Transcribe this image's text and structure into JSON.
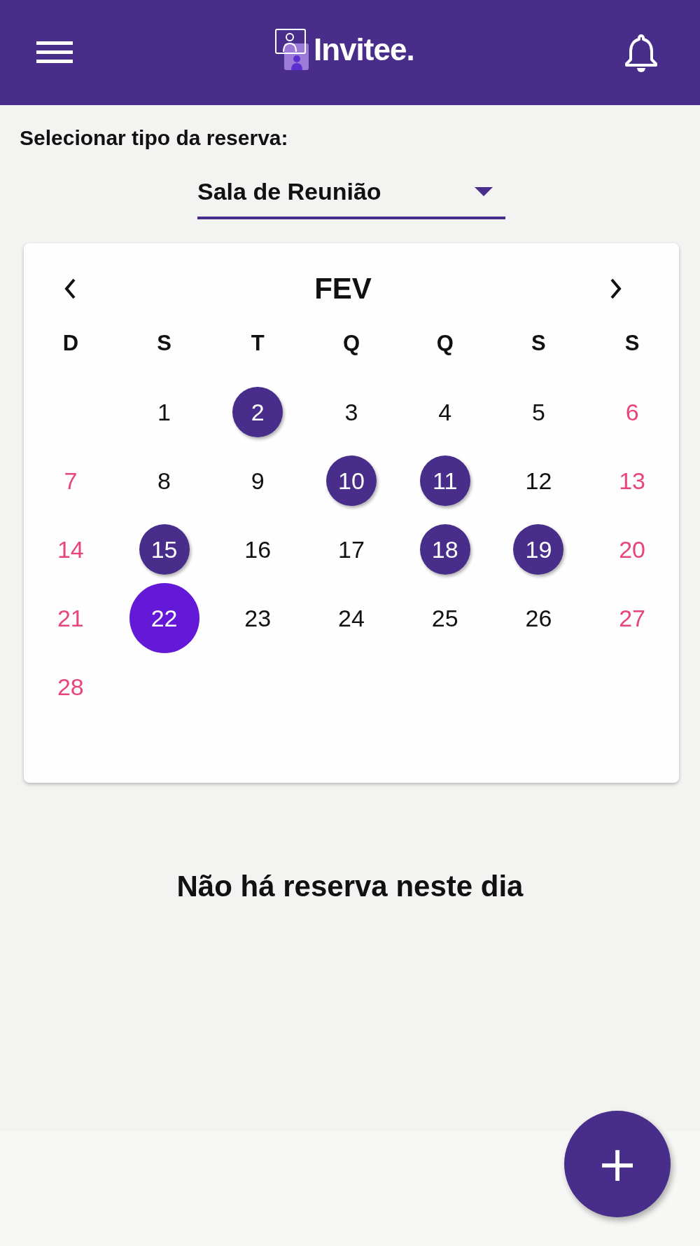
{
  "app_bar": {
    "brand": "Invitee."
  },
  "reservation_type": {
    "label": "Selecionar tipo da reserva:",
    "value": "Sala de Reunião"
  },
  "calendar": {
    "month": "FEV",
    "weekdays": [
      "D",
      "S",
      "T",
      "Q",
      "Q",
      "S",
      "S"
    ],
    "weeks": [
      [
        {
          "day": "1",
          "marked": false,
          "selected": false
        },
        {
          "day": "2",
          "marked": true,
          "selected": false
        },
        {
          "day": "3",
          "marked": false,
          "selected": false
        },
        {
          "day": "4",
          "marked": false,
          "selected": false
        },
        {
          "day": "5",
          "marked": false,
          "selected": false
        },
        {
          "day": "6",
          "marked": false,
          "selected": false
        }
      ],
      [
        {
          "day": "7",
          "marked": false,
          "selected": false
        },
        {
          "day": "8",
          "marked": false,
          "selected": false
        },
        {
          "day": "9",
          "marked": false,
          "selected": false
        },
        {
          "day": "10",
          "marked": true,
          "selected": false
        },
        {
          "day": "11",
          "marked": true,
          "selected": false
        },
        {
          "day": "12",
          "marked": false,
          "selected": false
        },
        {
          "day": "13",
          "marked": false,
          "selected": false
        }
      ],
      [
        {
          "day": "14",
          "marked": false,
          "selected": false
        },
        {
          "day": "15",
          "marked": true,
          "selected": false
        },
        {
          "day": "16",
          "marked": false,
          "selected": false
        },
        {
          "day": "17",
          "marked": false,
          "selected": false
        },
        {
          "day": "18",
          "marked": true,
          "selected": false
        },
        {
          "day": "19",
          "marked": true,
          "selected": false
        },
        {
          "day": "20",
          "marked": false,
          "selected": false
        }
      ],
      [
        {
          "day": "21",
          "marked": false,
          "selected": false
        },
        {
          "day": "22",
          "marked": false,
          "selected": true
        },
        {
          "day": "23",
          "marked": false,
          "selected": false
        },
        {
          "day": "24",
          "marked": false,
          "selected": false
        },
        {
          "day": "25",
          "marked": false,
          "selected": false
        },
        {
          "day": "26",
          "marked": false,
          "selected": false
        },
        {
          "day": "27",
          "marked": false,
          "selected": false
        }
      ],
      [
        {
          "day": "28",
          "marked": false,
          "selected": false
        }
      ]
    ]
  },
  "empty_message": "Não há reserva neste dia",
  "fab": {
    "label": "+"
  }
}
